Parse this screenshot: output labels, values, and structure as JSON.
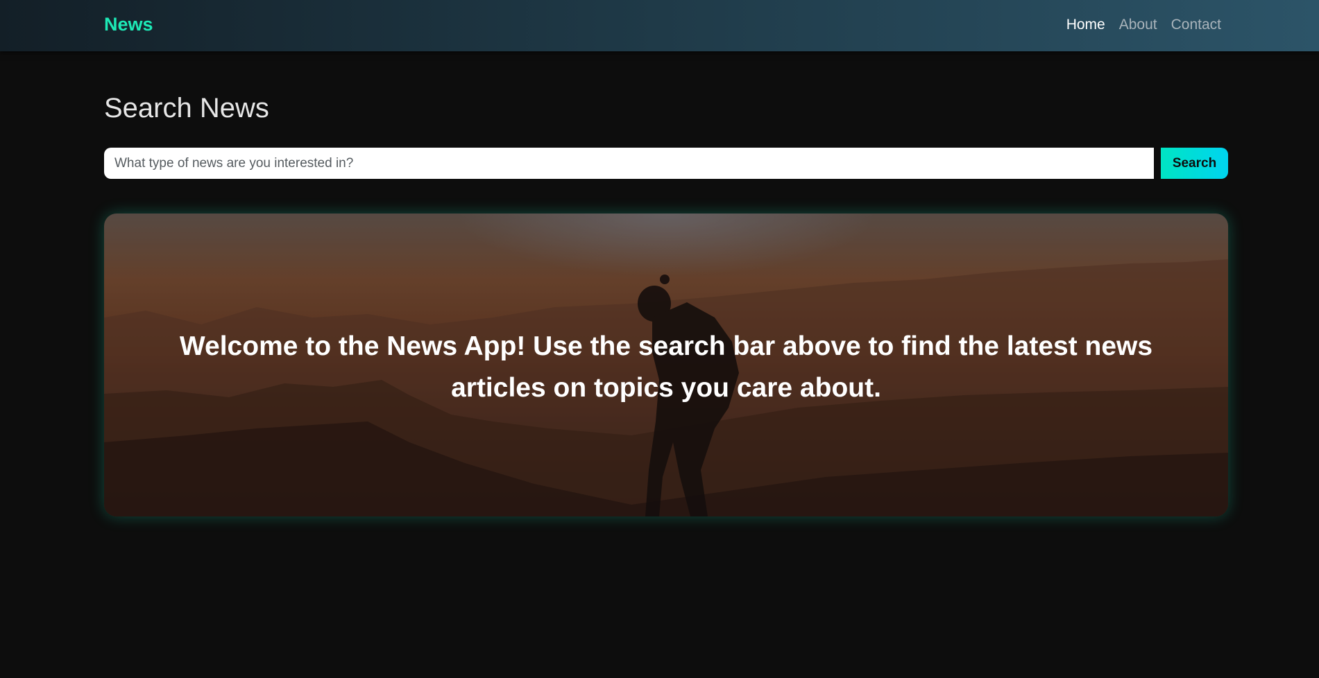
{
  "navbar": {
    "brand": "News",
    "links": [
      {
        "label": "Home"
      },
      {
        "label": "About"
      },
      {
        "label": "Contact"
      }
    ]
  },
  "main": {
    "title": "Search News",
    "search": {
      "placeholder": "What type of news are you interested in?",
      "value": "",
      "button_label": "Search"
    },
    "hero": {
      "message": "Welcome to the News App! Use the search bar above to find the latest news articles on topics you care about."
    }
  },
  "colors": {
    "brand": "#1de9b6",
    "accent": "#00d4f0",
    "background": "#0d0d0d"
  }
}
